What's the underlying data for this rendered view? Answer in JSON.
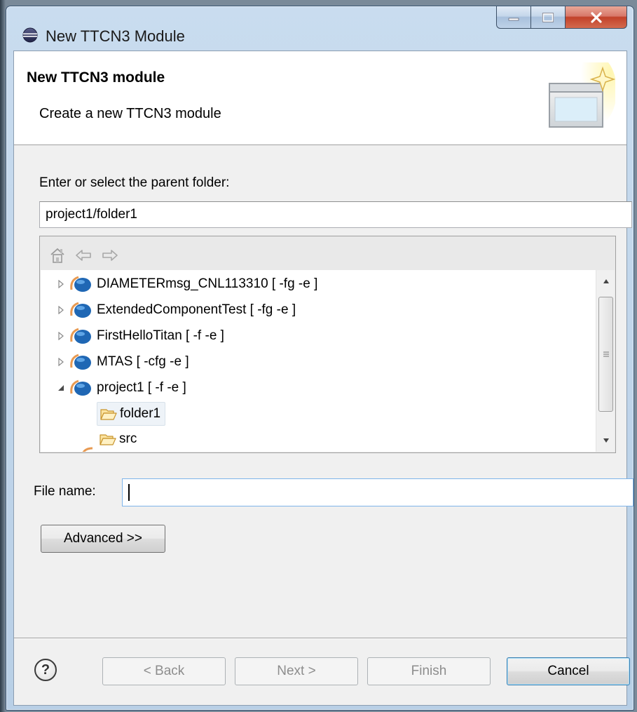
{
  "window": {
    "title": "New TTCN3 Module",
    "minimize_label": "_",
    "maximize_label": "□",
    "close_label": "X"
  },
  "header": {
    "title": "New TTCN3 module",
    "subtitle": "Create a new TTCN3 module"
  },
  "parent_folder": {
    "label": "Enter or select the parent folder:",
    "value": "project1/folder1"
  },
  "tree": {
    "items": [
      {
        "label": "DIAMETERmsg_CNL113310 [ -fg -e ]",
        "expanded": false
      },
      {
        "label": "ExtendedComponentTest [ -fg -e ]",
        "expanded": false
      },
      {
        "label": "FirstHelloTitan [ -f -e ]",
        "expanded": false
      },
      {
        "label": "MTAS [ -cfg -e ]",
        "expanded": false
      },
      {
        "label": "project1 [ -f -e ]",
        "expanded": true
      },
      {
        "label": "folder1",
        "selected": true
      },
      {
        "label": "src"
      }
    ]
  },
  "file_name": {
    "label": "File name:",
    "value": ""
  },
  "buttons": {
    "advanced": "Advanced >>",
    "back": "< Back",
    "next": "Next >",
    "finish": "Finish",
    "cancel": "Cancel",
    "help": "?"
  }
}
